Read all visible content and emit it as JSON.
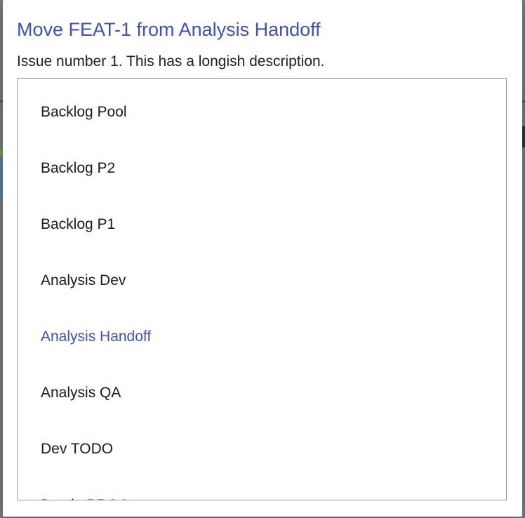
{
  "dialog": {
    "title": "Move FEAT-1 from Analysis Handoff",
    "description": "Issue number 1. This has a longish description."
  },
  "columns": [
    {
      "label": "Backlog Pool",
      "current": false
    },
    {
      "label": "Backlog P2",
      "current": false
    },
    {
      "label": "Backlog P1",
      "current": false
    },
    {
      "label": "Analysis Dev",
      "current": false
    },
    {
      "label": "Analysis Handoff",
      "current": true
    },
    {
      "label": "Analysis QA",
      "current": false
    },
    {
      "label": "Dev TODO",
      "current": false
    },
    {
      "label": "Dev in PROG",
      "current": false
    }
  ],
  "colors": {
    "accent": "#3f51b5",
    "text": "#1a1a1a",
    "backdrop": "#7d7d7d"
  }
}
